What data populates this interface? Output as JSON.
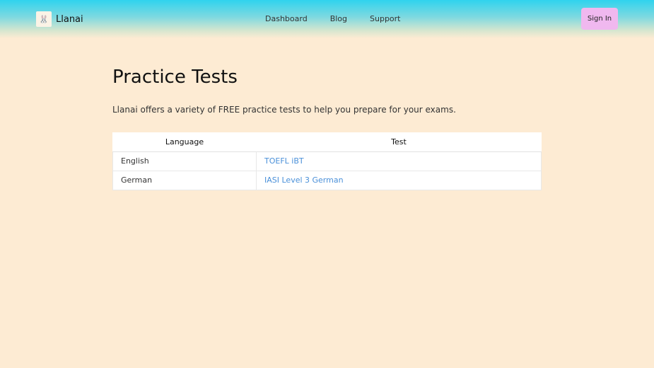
{
  "header": {
    "brand": "Llanai",
    "logo_icon": "🐰",
    "nav": [
      "Dashboard",
      "Blog",
      "Support"
    ],
    "signin_label": "Sign In"
  },
  "main": {
    "title": "Practice Tests",
    "intro": "Llanai offers a variety of FREE practice tests to help you prepare for your exams.",
    "table": {
      "headers": [
        "Language",
        "Test"
      ],
      "rows": [
        {
          "language": "English",
          "test": "TOEFL iBT"
        },
        {
          "language": "German",
          "test": "IASI Level 3 German"
        }
      ]
    }
  },
  "colors": {
    "background": "#fdebd3",
    "header_top": "#2fd3ee",
    "signin_bg": "#f0b8ef",
    "link": "#4a90d9"
  }
}
